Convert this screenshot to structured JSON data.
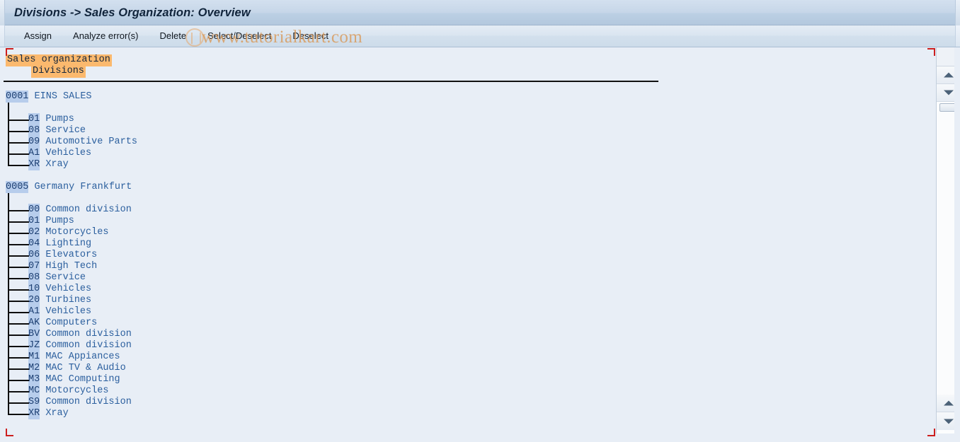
{
  "window": {
    "title": "Divisions -> Sales Organization: Overview"
  },
  "toolbar": {
    "buttons": [
      {
        "label": "Assign",
        "name": "assign-button"
      },
      {
        "label": "Analyze error(s)",
        "name": "analyze-errors-button"
      },
      {
        "label": "Delete",
        "name": "delete-button"
      },
      {
        "label": "Select/Deselect",
        "name": "select-deselect-button"
      },
      {
        "label": "Deselect",
        "name": "deselect-button"
      }
    ]
  },
  "watermark": {
    "text": "www.tutorialkart.com",
    "color": "#d99a5b"
  },
  "columns": {
    "level1": "Sales organization",
    "level2": "Divisions"
  },
  "colors": {
    "header_highlight": "#fbb96e",
    "code_highlight": "#b7cdec",
    "label_text": "#2b5f9e",
    "canvas": "#e8eef6",
    "corner_mark": "#cc1f1f"
  },
  "tree": {
    "groups": [
      {
        "code": "0001",
        "label": "EINS SALES",
        "children": [
          {
            "code": "01",
            "label": "Pumps"
          },
          {
            "code": "08",
            "label": "Service"
          },
          {
            "code": "09",
            "label": "Automotive Parts"
          },
          {
            "code": "A1",
            "label": "Vehicles"
          },
          {
            "code": "XR",
            "label": "Xray"
          }
        ]
      },
      {
        "code": "0005",
        "label": "Germany Frankfurt",
        "children": [
          {
            "code": "00",
            "label": "Common division"
          },
          {
            "code": "01",
            "label": "Pumps"
          },
          {
            "code": "02",
            "label": "Motorcycles"
          },
          {
            "code": "04",
            "label": "Lighting"
          },
          {
            "code": "06",
            "label": "Elevators"
          },
          {
            "code": "07",
            "label": "High Tech"
          },
          {
            "code": "08",
            "label": "Service"
          },
          {
            "code": "10",
            "label": "Vehicles"
          },
          {
            "code": "20",
            "label": "Turbines"
          },
          {
            "code": "A1",
            "label": "Vehicles"
          },
          {
            "code": "AK",
            "label": "Computers"
          },
          {
            "code": "BV",
            "label": "Common division"
          },
          {
            "code": "JZ",
            "label": "Common division"
          },
          {
            "code": "M1",
            "label": "MAC Appiances"
          },
          {
            "code": "M2",
            "label": "MAC TV & Audio"
          },
          {
            "code": "M3",
            "label": "MAC Computing"
          },
          {
            "code": "MC",
            "label": "Motorcycles"
          },
          {
            "code": "S9",
            "label": "Common division"
          },
          {
            "code": "XR",
            "label": "Xray"
          }
        ]
      }
    ]
  },
  "scrollbar": {
    "up_icon": "triangle-up-icon",
    "down_icon": "triangle-down-icon"
  }
}
